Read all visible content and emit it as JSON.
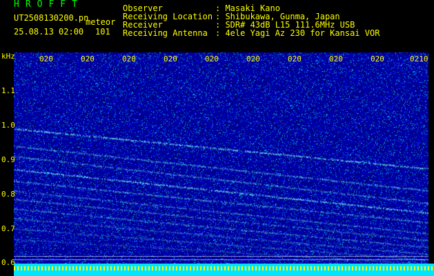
{
  "brand": "HROFFT",
  "file": {
    "name": "UT2508130200.pn",
    "type": "meteor",
    "datetime": "25.08.13 02:00",
    "count": "101"
  },
  "info": {
    "observer_label": "Observer",
    "observer_value": ": Masaki Kano",
    "location_label": "Receiving Location",
    "location_value": ": Shibukawa, Gunma, Japan",
    "receiver_label": "Receiver",
    "receiver_value": ": SDR# 43dB L15 111.6MHz USB",
    "antenna_label": "Receiving Antenna",
    "antenna_value": ": 4ele Yagi Az 230 for Kansai VOR"
  },
  "y_axis": {
    "unit": "kHz",
    "ticks": [
      "1.1",
      "1.0",
      "0.9",
      "0.8",
      "0.7",
      "0.6"
    ]
  },
  "x_axis": {
    "ticks": [
      "020",
      "020",
      "020",
      "020",
      "020",
      "020",
      "020",
      "020",
      "020",
      "0210"
    ]
  },
  "colors": {
    "background": "#000000",
    "text": "#ffff00",
    "brand": "#00ff00",
    "noise": "#0000cc",
    "signal": "#7fffff"
  }
}
